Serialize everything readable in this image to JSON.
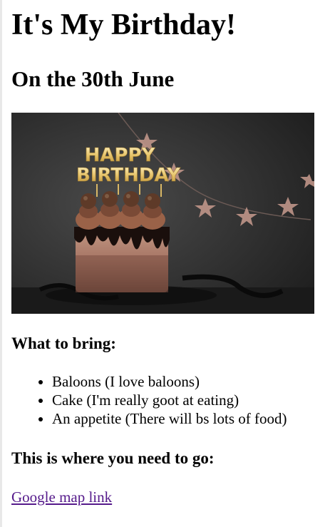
{
  "header": {
    "title": "It's My Birthday!",
    "subtitle": "On the 30th June"
  },
  "hero_image": {
    "topper_line1": "HAPPY",
    "topper_line2": "BIRTHDAY"
  },
  "bring": {
    "heading": "What to bring:",
    "items": [
      "Baloons (I love baloons)",
      "Cake (I'm really goot at eating)",
      "An appetite (There will bs lots of food)"
    ]
  },
  "directions": {
    "heading": "This is where you need to go:",
    "link_text": "Google map link"
  },
  "colors": {
    "link_visited": "#551a8b",
    "background": "#ffffff"
  }
}
